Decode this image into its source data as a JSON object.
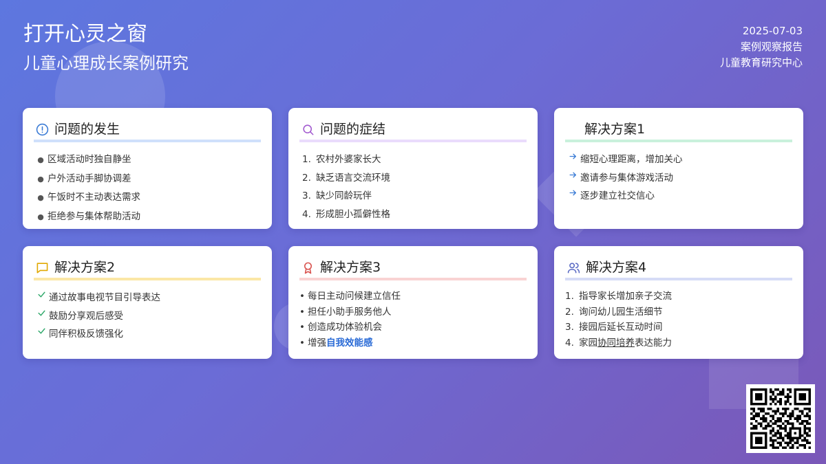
{
  "header": {
    "title": "打开心灵之窗",
    "subtitle": "儿童心理成长案例研究",
    "date": "2025-07-03",
    "report_type": "案例观察报告",
    "org": "儿童教育研究中心"
  },
  "cards": [
    {
      "title": "问题的发生",
      "icon": "alert-circle-icon",
      "accent": "#cfe0fb",
      "icon_color": "#3a7bd5",
      "items": [
        "区域活动时独自静坐",
        "户外活动手脚协调差",
        "午饭时不主动表达需求",
        "拒绝参与集体帮助活动"
      ]
    },
    {
      "title": "问题的症结",
      "icon": "search-icon",
      "accent": "#eadcfc",
      "icon_color": "#a35bd0",
      "items": [
        "农村外婆家长大",
        "缺乏语言交流环境",
        "缺少同龄玩伴",
        "形成胆小孤僻性格"
      ]
    },
    {
      "title": "解决方案1",
      "icon": "",
      "accent": "#c9f1dc",
      "icon_color": "#3a7bd5",
      "items": [
        "缩短心理距离，增加关心",
        "邀请参与集体游戏活动",
        "逐步建立社交信心"
      ]
    },
    {
      "title": "解决方案2",
      "icon": "message-square-icon",
      "accent": "#fbe7a6",
      "icon_color": "#e0a800",
      "items": [
        "通过故事电视节目引导表达",
        "鼓励分享观后感受",
        "同伴积极反馈强化"
      ]
    },
    {
      "title": "解决方案3",
      "icon": "award-icon",
      "accent": "#f9d3d3",
      "icon_color": "#d9534f",
      "items": [
        "每日主动问候建立信任",
        "担任小助手服务他人",
        "创造成功体验机会"
      ],
      "last_item_prefix": "增强",
      "last_item_emphasis": "自我效能感"
    },
    {
      "title": "解决方案4",
      "icon": "users-icon",
      "accent": "#d6dcf6",
      "icon_color": "#5b6bc4",
      "items": [
        "指导家长增加亲子交流",
        "询问幼儿园生活细节",
        "接园后延长互动时间"
      ],
      "last_item_prefix": "家园",
      "last_item_underlined": "协同培养",
      "last_item_suffix": "表达能力"
    }
  ],
  "colors": {
    "arrow": "#3a7bd5",
    "check": "#2fa86a",
    "emphasis": "#2a6bd6"
  }
}
